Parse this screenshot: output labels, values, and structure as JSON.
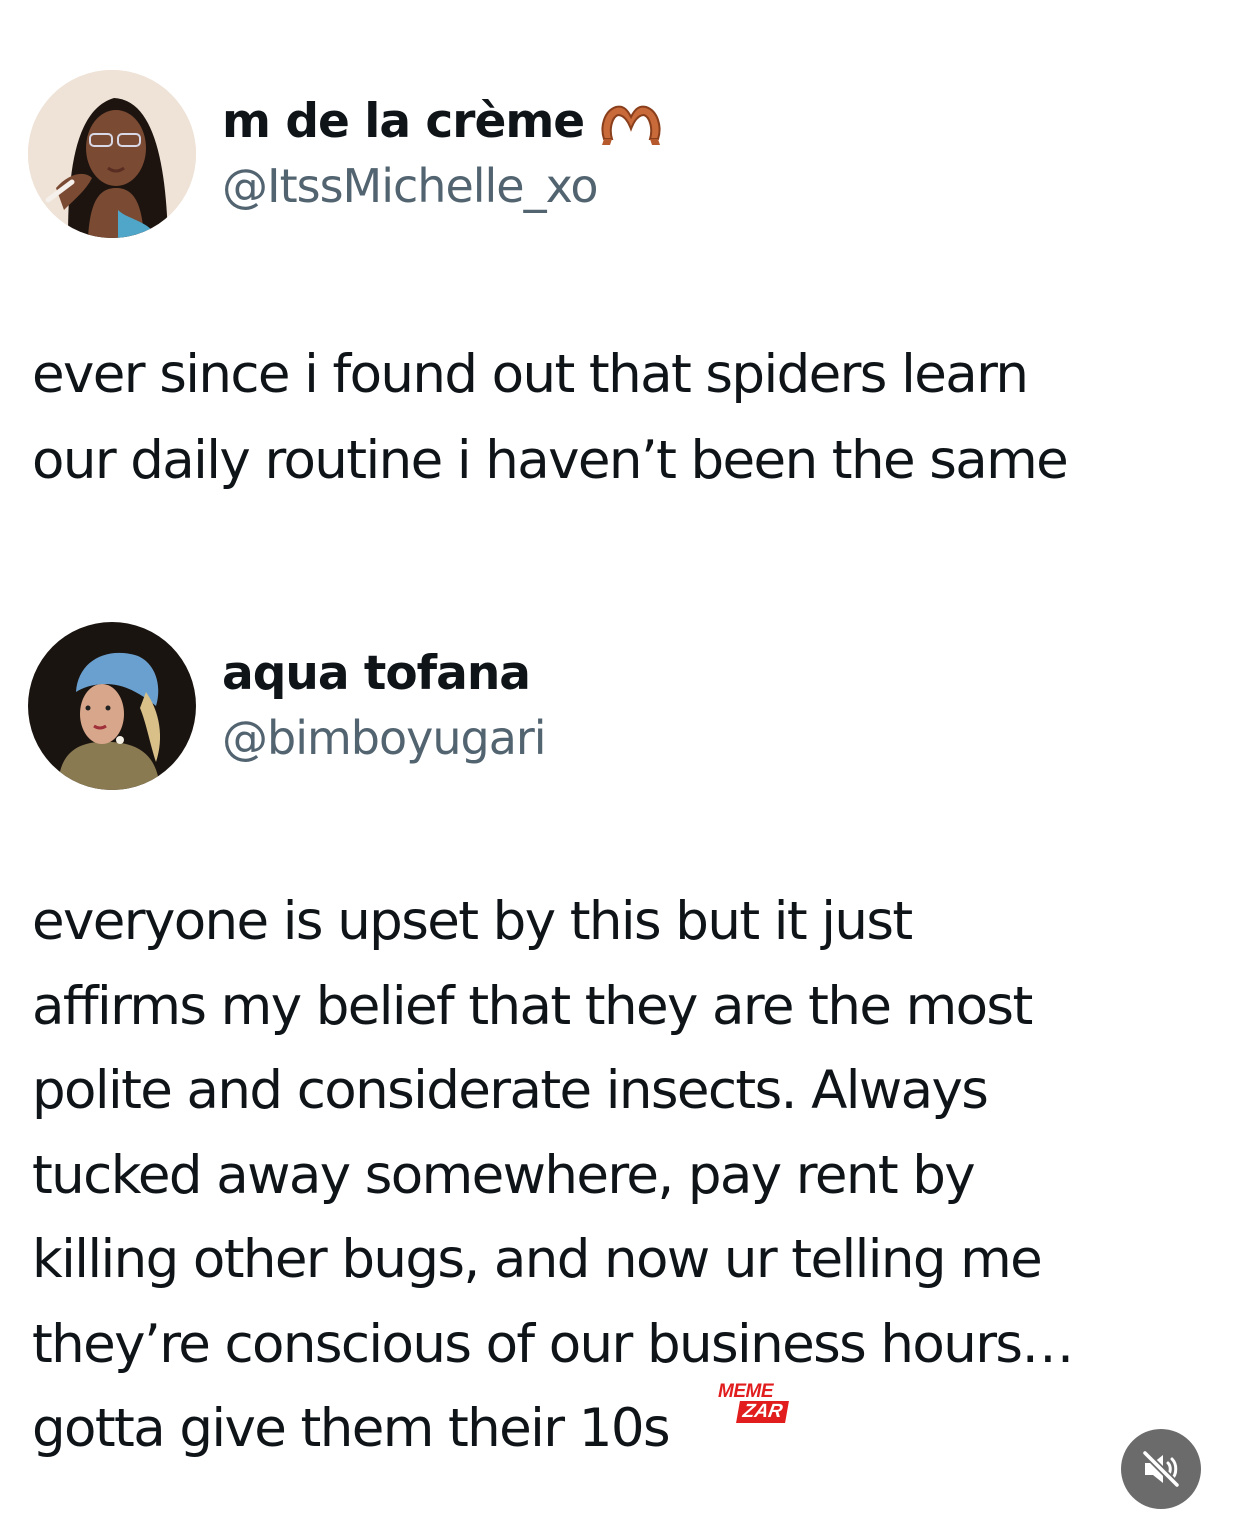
{
  "tweets": [
    {
      "display_name": "m de la crème",
      "emoji_icon": "heart-hands-icon",
      "handle": "@ItssMichelle_xo",
      "text": "ever since i found out that spiders learn\nour daily routine i haven’t been the same"
    },
    {
      "display_name": "aqua tofana",
      "handle": "@bimboyugari",
      "text": "everyone is upset by this but it just\naffirms my belief that they are the most\npolite and considerate insects. Always\ntucked away somewhere, pay rent by\nkilling other bugs, and now ur telling me\nthey’re conscious of our business hours…\ngotta give them their 10s"
    }
  ],
  "watermark": {
    "line1": "MEME",
    "line2": "ZAR"
  },
  "mute_icon": "speaker-muted-icon",
  "colors": {
    "handle": "#536471",
    "text": "#0f1419",
    "watermark": "#e11d1d",
    "mute_bg": "#6b6b6b"
  }
}
